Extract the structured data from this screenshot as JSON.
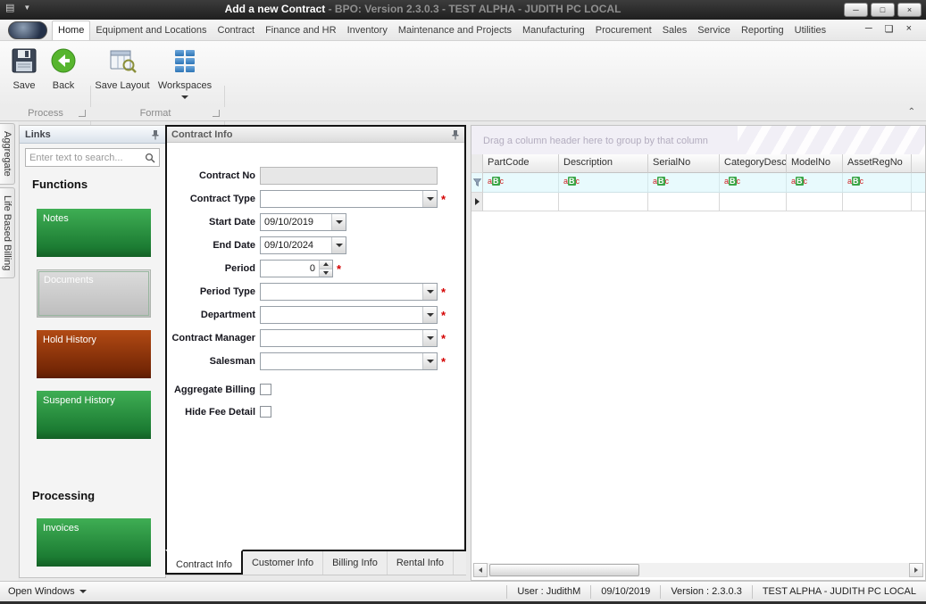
{
  "window": {
    "title_main": "Add a new Contract",
    "title_rest": " - BPO: Version 2.3.0.3 - TEST ALPHA - JUDITH PC LOCAL",
    "minimize": "─",
    "maximize": "□",
    "close": "×"
  },
  "ribbon": {
    "tabs": [
      {
        "label": "Home"
      },
      {
        "label": "Equipment and Locations"
      },
      {
        "label": "Contract"
      },
      {
        "label": "Finance and HR"
      },
      {
        "label": "Inventory"
      },
      {
        "label": "Maintenance and Projects"
      },
      {
        "label": "Manufacturing"
      },
      {
        "label": "Procurement"
      },
      {
        "label": "Sales"
      },
      {
        "label": "Service"
      },
      {
        "label": "Reporting"
      },
      {
        "label": "Utilities"
      }
    ],
    "buttons": {
      "save": "Save",
      "back": "Back",
      "save_layout": "Save Layout",
      "workspaces": "Workspaces"
    },
    "groups": {
      "process": "Process",
      "format": "Format"
    }
  },
  "dock_tabs": {
    "aggregate": "Aggregate",
    "life_based_billing": "Life Based Billing"
  },
  "links": {
    "title": "Links",
    "search_placeholder": "Enter text to search...",
    "functions_heading": "Functions",
    "processing_heading": "Processing",
    "buttons": {
      "notes": "Notes",
      "documents": "Documents",
      "hold_history": "Hold History",
      "suspend_history": "Suspend History",
      "invoices": "Invoices"
    }
  },
  "contract": {
    "title": "Contract Info",
    "labels": {
      "contract_no": "Contract No",
      "contract_type": "Contract Type",
      "start_date": "Start Date",
      "end_date": "End Date",
      "period": "Period",
      "period_type": "Period Type",
      "department": "Department",
      "contract_manager": "Contract Manager",
      "salesman": "Salesman",
      "aggregate_billing": "Aggregate Billing",
      "hide_fee_detail": "Hide Fee Detail"
    },
    "values": {
      "contract_no": "",
      "contract_type": "",
      "start_date": "09/10/2019",
      "end_date": "09/10/2024",
      "period": "0",
      "period_type": "",
      "department": "",
      "contract_manager": "",
      "salesman": ""
    },
    "required_marker": "*",
    "tabs": [
      {
        "label": "Contract Info"
      },
      {
        "label": "Customer Info"
      },
      {
        "label": "Billing Info"
      },
      {
        "label": "Rental Info"
      }
    ]
  },
  "grid": {
    "group_hint": "Drag a column header here to group by that column",
    "columns": [
      {
        "label": "PartCode"
      },
      {
        "label": "Description"
      },
      {
        "label": "SerialNo"
      },
      {
        "label": "CategoryDesc"
      },
      {
        "label": "ModelNo"
      },
      {
        "label": "AssetRegNo"
      }
    ],
    "filter_glyph": {
      "first": "a",
      "second": "B",
      "third": "c"
    }
  },
  "status_bar": {
    "open_windows": "Open Windows",
    "user": "User : JudithM",
    "date": "09/10/2019",
    "version": "Version : 2.3.0.3",
    "environment": "TEST ALPHA - JUDITH PC LOCAL"
  }
}
